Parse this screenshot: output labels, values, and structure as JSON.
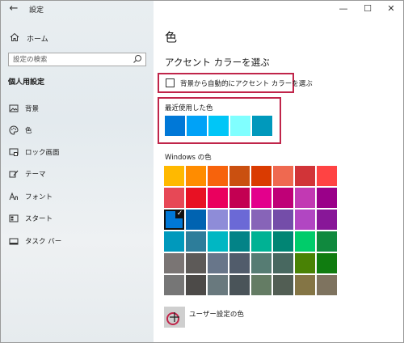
{
  "window": {
    "app_title": "設定",
    "back_glyph": "←",
    "controls": [
      "—",
      "☐",
      "✕"
    ]
  },
  "sidebar": {
    "home_label": "ホーム",
    "search_placeholder": "設定の検索",
    "section_label": "個人用設定",
    "items": [
      {
        "label": "背景",
        "icon": "picture-icon"
      },
      {
        "label": "色",
        "icon": "palette-icon"
      },
      {
        "label": "ロック画面",
        "icon": "lock-screen-icon"
      },
      {
        "label": "テーマ",
        "icon": "theme-icon"
      },
      {
        "label": "フォント",
        "icon": "font-icon"
      },
      {
        "label": "スタート",
        "icon": "start-icon"
      },
      {
        "label": "タスク バー",
        "icon": "taskbar-icon"
      }
    ]
  },
  "main": {
    "title": "色",
    "accent_heading": "アクセント カラーを選ぶ",
    "auto_accent_label": "背景から自動的にアクセント カラーを選ぶ",
    "auto_accent_checked": false,
    "recent_label": "最近使用した色",
    "recent_colors": [
      "#0078d7",
      "#00a2f7",
      "#00c6f7",
      "#80ffff",
      "#0099bc"
    ],
    "windows_colors_label": "Windows の色",
    "windows_colors": [
      [
        "#ffb900",
        "#ff8c00",
        "#f7630c",
        "#ca5010",
        "#da3b01",
        "#ef6950",
        "#d13438",
        "#ff4343"
      ],
      [
        "#e74856",
        "#e81123",
        "#ea005e",
        "#c30052",
        "#e3008c",
        "#bf0077",
        "#c239b3",
        "#9a0089"
      ],
      [
        "#0078d7",
        "#0063b1",
        "#8e8cd8",
        "#6b69d6",
        "#8764b8",
        "#744da9",
        "#b146c2",
        "#881798"
      ],
      [
        "#0099bc",
        "#2d7d9a",
        "#00b7c3",
        "#038387",
        "#00b294",
        "#018574",
        "#00cc6a",
        "#10893e"
      ],
      [
        "#7a7574",
        "#5d5a58",
        "#68768a",
        "#515c6b",
        "#567c73",
        "#486860",
        "#498205",
        "#107c10"
      ],
      [
        "#767676",
        "#4c4a48",
        "#69797e",
        "#4a5459",
        "#647c64",
        "#525e54",
        "#847545",
        "#7e735f"
      ]
    ],
    "selected_color": "#0078d7",
    "custom_color_label": "ユーザー設定の色",
    "highlight_color": "#c0254a"
  }
}
